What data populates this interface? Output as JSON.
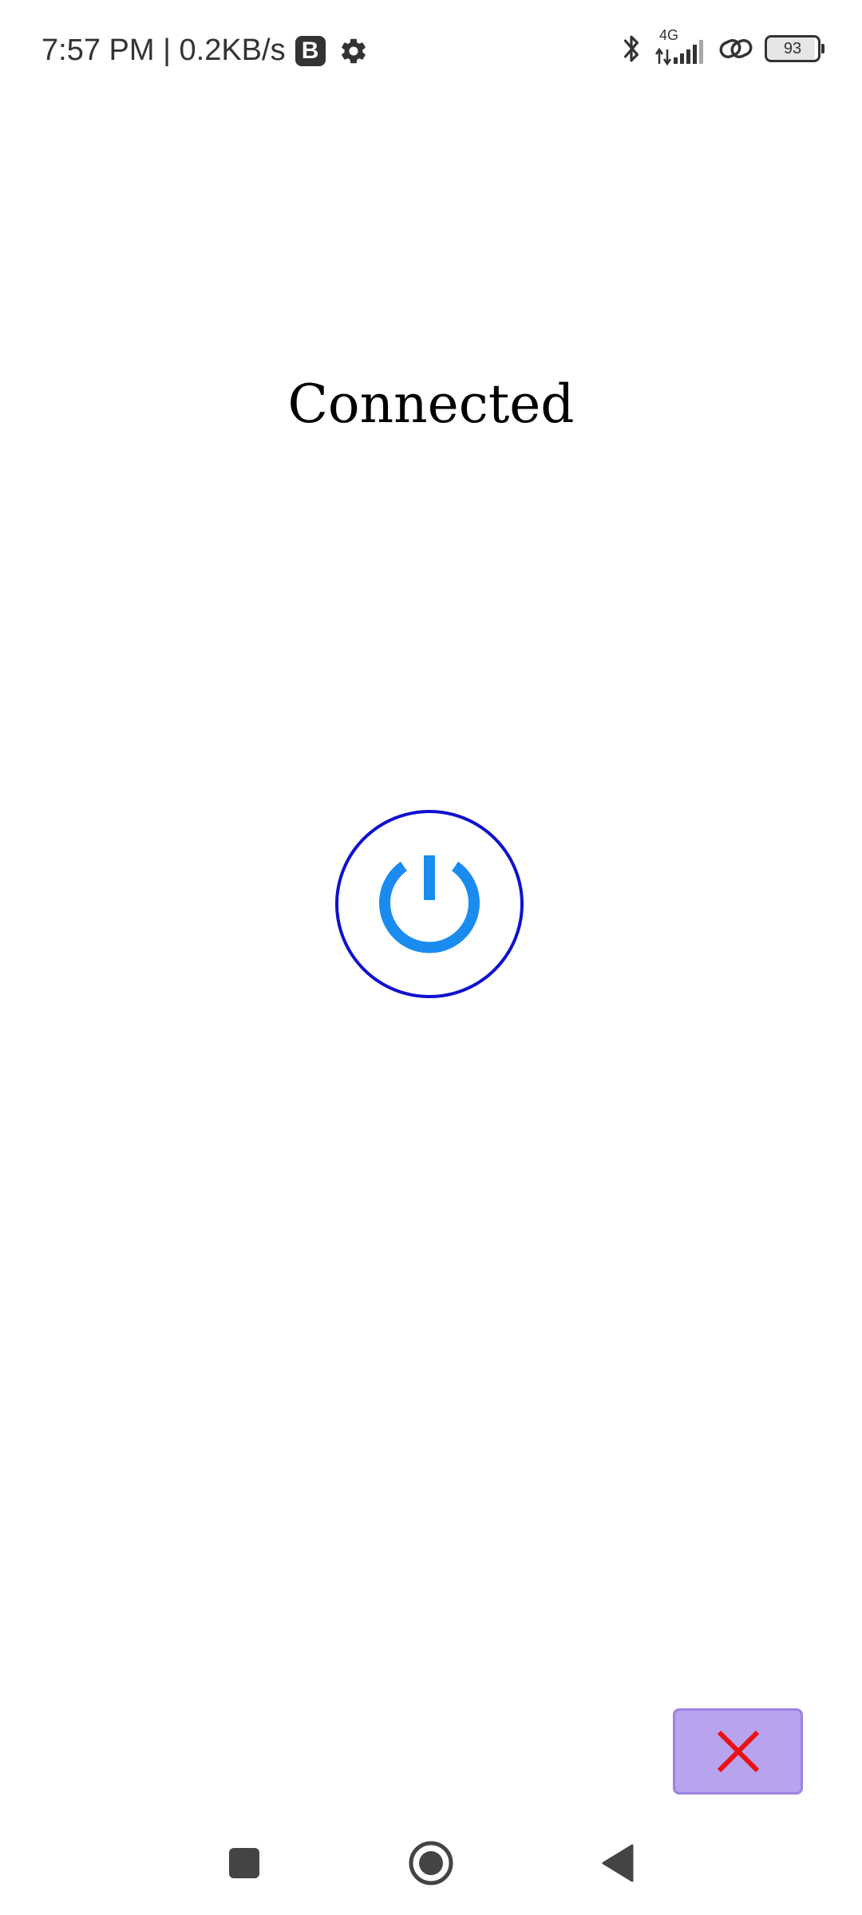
{
  "status_bar": {
    "time_speed": "7:57 PM | 0.2KB/s",
    "b_badge": "B",
    "network": "4G",
    "battery": "93",
    "icons": [
      "settings-gear-icon",
      "bluetooth-icon",
      "signal-icon",
      "link-icon",
      "battery-icon"
    ]
  },
  "main": {
    "status_text": "Connected",
    "power_icon": "power-icon",
    "power_icon_color": "#1a8cf0",
    "power_ring_color": "#1010d0"
  },
  "fab": {
    "icon": "close-icon",
    "icon_color": "#ee1111",
    "background": "#b7a3ee"
  },
  "nav": {
    "icons": [
      "recent-apps-icon",
      "home-icon",
      "back-icon"
    ]
  }
}
